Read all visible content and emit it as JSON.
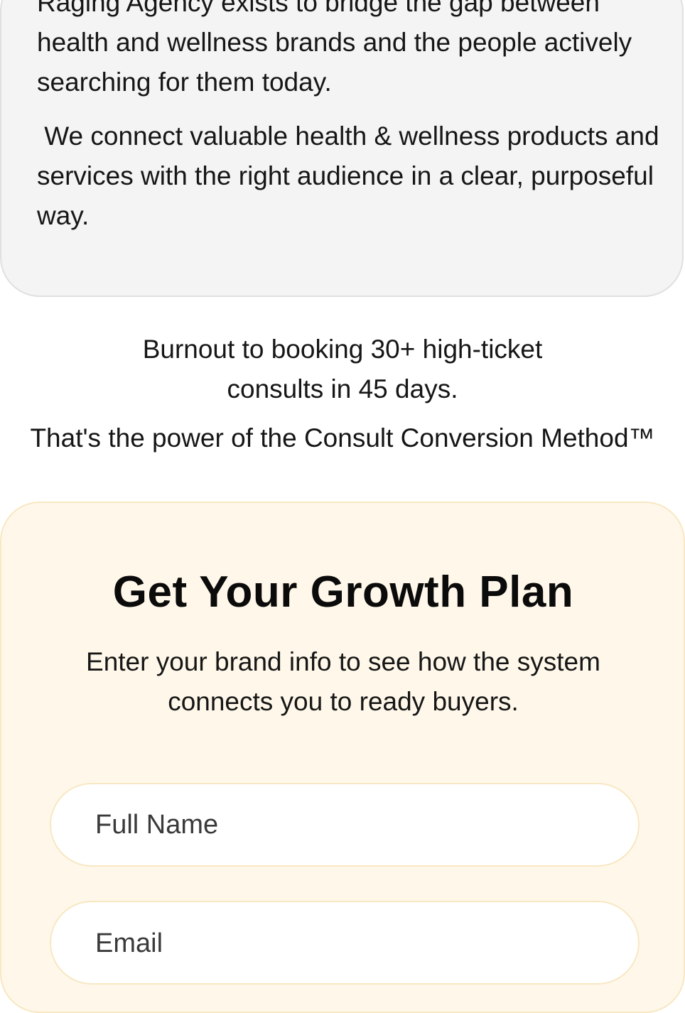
{
  "about": {
    "paragraph_1": "Raging Agency exists to bridge the gap between health and wellness brands and the people actively searching for them today.",
    "paragraph_2": " We connect valuable health & wellness products and services with the right audience in a clear, purposeful way."
  },
  "headline": {
    "line_1": "Burnout to booking 30+ high-ticket",
    "line_2": "consults in 45 days.",
    "line_3": "That's the power of the Consult Conversion Method™"
  },
  "form": {
    "title": "Get Your Growth Plan",
    "subtitle": "Enter your brand info to see how the system connects you to ready buyers.",
    "full_name_placeholder": "Full Name",
    "email_placeholder": "Email"
  },
  "colors": {
    "about_card_bg": "#f4f4f4",
    "form_card_bg": "#fff8ea",
    "form_card_border": "#f8e7c3"
  }
}
